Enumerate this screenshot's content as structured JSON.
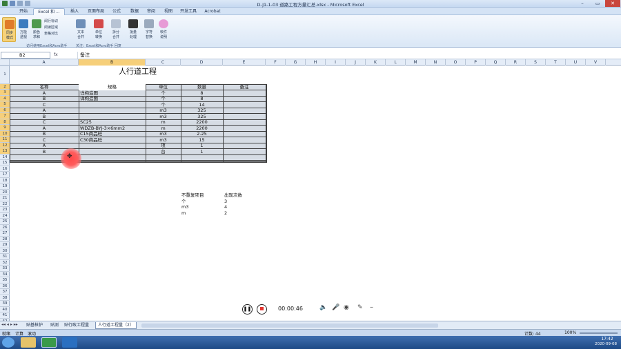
{
  "window": {
    "title": "D-J1-1-03 道路工程方量汇总.xlsx - Microsoft Excel",
    "minimize": "–",
    "restore": "▭",
    "close": "✕"
  },
  "menu_tabs": [
    "开始",
    "Excel 和 ...",
    "插入",
    "页面布局",
    "公式",
    "数据",
    "审阅",
    "视图",
    "开发工具",
    "Acrobat"
  ],
  "ribbon": {
    "buttons": [
      {
        "label": "同步\n模式",
        "icon": "sync-mode-icon"
      },
      {
        "label": "万能\n透视",
        "icon": "pivot-icon"
      },
      {
        "label": "颜色\n求和",
        "icon": "color-sum-icon"
      },
      {
        "label": "文本\n合并",
        "icon": "text-merge-icon"
      },
      {
        "label": "单位\n转换",
        "icon": "unit-convert-icon"
      },
      {
        "label": "拆分\n合并",
        "icon": "split-icon"
      },
      {
        "label": "批量\n处理",
        "icon": "batch-icon"
      },
      {
        "label": "字符\n替换",
        "icon": "replace-icon"
      },
      {
        "label": "软件\n说明",
        "icon": "help-icon"
      }
    ],
    "small_buttons": [
      "阅行标识",
      "阅读区域",
      "表格对比"
    ],
    "caption_left": "访问使用Excel和Acro助手",
    "caption_right": "关注：Excel和Acro助手 回复"
  },
  "name_box": "B2",
  "fx_label": "fx",
  "formula_value": "备注",
  "columns": [
    "A",
    "B",
    "C",
    "D",
    "E",
    "F",
    "G",
    "H",
    "I",
    "J",
    "K",
    "L",
    "M",
    "N",
    "O",
    "P",
    "Q",
    "R",
    "S",
    "T",
    "U",
    "V"
  ],
  "rows": [
    "1",
    "2",
    "3",
    "4",
    "5",
    "6",
    "7",
    "8",
    "9",
    "10",
    "11",
    "12",
    "13",
    "14",
    "15",
    "16",
    "17",
    "18",
    "19",
    "20",
    "21",
    "22",
    "23",
    "24",
    "25",
    "26",
    "27",
    "28",
    "29",
    "30",
    "31",
    "32",
    "33",
    "34",
    "35",
    "36",
    "37",
    "38",
    "39",
    "40",
    "41",
    "42",
    "43"
  ],
  "sheet_title": "人行道工程",
  "table": {
    "headers": [
      "名称",
      "规格",
      "单位",
      "数量",
      "备注"
    ],
    "rows": [
      [
        "A",
        "详构造图",
        "个",
        "8",
        ""
      ],
      [
        "B",
        "详构造图",
        "个",
        "8",
        ""
      ],
      [
        "C",
        "",
        "个",
        "14",
        ""
      ],
      [
        "A",
        "",
        "m3",
        "325",
        ""
      ],
      [
        "B",
        "",
        "m3",
        "325",
        ""
      ],
      [
        "C",
        "SC25",
        "m",
        "2200",
        ""
      ],
      [
        "A",
        "WDZB-BYJ-3×6mm2",
        "m",
        "2200",
        ""
      ],
      [
        "B",
        "C15商品砼",
        "m3",
        "2.25",
        ""
      ],
      [
        "C",
        "C30商品砼",
        "m3",
        "15",
        ""
      ],
      [
        "A",
        "",
        "项",
        "1",
        ""
      ],
      [
        "B",
        "",
        "台",
        "1",
        ""
      ]
    ]
  },
  "summary": {
    "headers": [
      "不重复项目",
      "出现次数"
    ],
    "rows": [
      [
        "个",
        "3"
      ],
      [
        "m3",
        "4"
      ],
      [
        "m",
        "2"
      ]
    ]
  },
  "sheet_tabs": [
    "贴基桩护",
    "贴测",
    "贴行政工程量",
    "人行道工程量（2）"
  ],
  "status": {
    "left": [
      "就绪",
      "计算",
      "滚动"
    ],
    "count": "计数: 44",
    "zoom": "100%"
  },
  "recorder": {
    "time": "00:00:46"
  },
  "taskbar": {
    "clock_time": "17:42",
    "clock_date": "2020-09-08"
  }
}
